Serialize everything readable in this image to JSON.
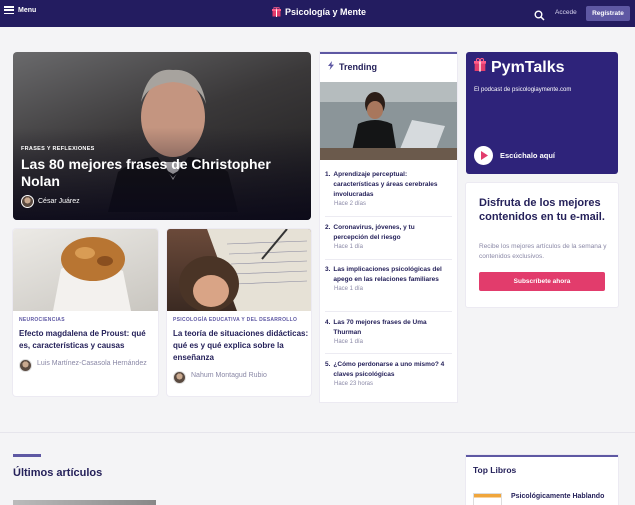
{
  "topbar": {
    "menu_label": "Menu",
    "brand": "Psicología y Mente",
    "login_label": "Accede",
    "register_label": "Regístrate"
  },
  "hero": {
    "category": "FRASES Y REFLEXIONES",
    "title": "Las 80 mejores frases de Christopher Nolan",
    "author": "César Juárez"
  },
  "cards": [
    {
      "category": "NEUROCIENCIAS",
      "title": "Efecto magdalena de Proust: qué es, características y causas",
      "author": "Luis Martínez-Casasola Hernández"
    },
    {
      "category": "PSICOLOGÍA EDUCATIVA Y DEL DESARROLLO",
      "title": "La teoría de situaciones didácticas: qué es y qué explica sobre la enseñanza",
      "author": "Nahum Montagud Rubio"
    }
  ],
  "trending": {
    "heading": "Trending",
    "items": [
      {
        "num": "1.",
        "title": "Aprendizaje perceptual: características y áreas cerebrales involucradas",
        "date": "Hace 2 días"
      },
      {
        "num": "2.",
        "title": "Coronavirus, jóvenes, y tu percepción del riesgo",
        "date": "Hace 1 día"
      },
      {
        "num": "3.",
        "title": "Las implicaciones psicológicas del apego en las relaciones familiares",
        "date": "Hace 1 día"
      },
      {
        "num": "4.",
        "title": "Las 70 mejores frases de Uma Thurman",
        "date": "Hace 1 día"
      },
      {
        "num": "5.",
        "title": "¿Cómo perdonarse a uno mismo? 4 claves psicológicas",
        "date": "Hace 23 horas"
      }
    ]
  },
  "podcast": {
    "name": "PymTalks",
    "subtitle": "El podcast de psicologiaymente.com",
    "listen_label": "Escúchalo aquí"
  },
  "newsletter": {
    "title": "Disfruta de los mejores contenidos en tu e-mail.",
    "description": "Recibe los mejores artículos de la semana y contenidos exclusivos.",
    "button_label": "Subscríbete ahora"
  },
  "latest": {
    "title": "Últimos artículos"
  },
  "top_books": {
    "title": "Top Libros",
    "first_book": "Psicológicamente Hablando"
  },
  "colors": {
    "topbar": "#231c60",
    "accent": "#5e58a3",
    "podcast_bg": "#2e237a",
    "cta": "#e23c6c"
  }
}
